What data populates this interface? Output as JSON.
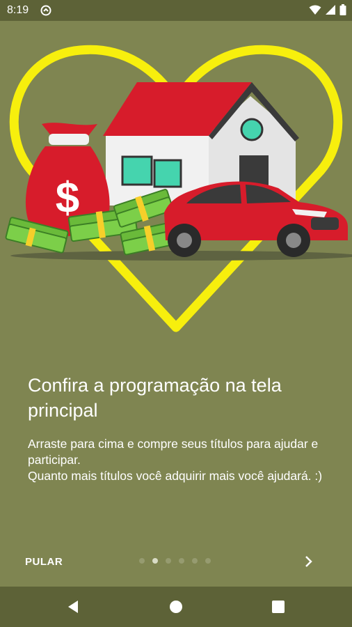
{
  "status_bar": {
    "time": "8:19",
    "icons": [
      "do-not-disturb-icon",
      "wifi-icon",
      "signal-icon",
      "battery-icon"
    ]
  },
  "onboarding": {
    "illustration": [
      "heart-outline",
      "money-bag-icon",
      "house-icon",
      "cash-stack-icon",
      "car-icon"
    ],
    "title": "Confira a programação na tela principal",
    "description_lines": [
      "Arraste para cima e compre seus títulos para ajudar e participar.",
      "Quanto mais títulos você adquirir mais você ajudará. :)"
    ],
    "skip_label": "PULAR",
    "page_count": 6,
    "active_page": 2,
    "next_icon": "chevron-right-icon"
  },
  "navigation_bar": {
    "buttons": [
      "back-icon",
      "home-icon",
      "recents-icon"
    ]
  },
  "colors": {
    "background": "#7f8551",
    "bars": "#5d6237",
    "heart": "#f7ef0d",
    "red": "#d71c2b",
    "cash": "#6aba3a"
  }
}
